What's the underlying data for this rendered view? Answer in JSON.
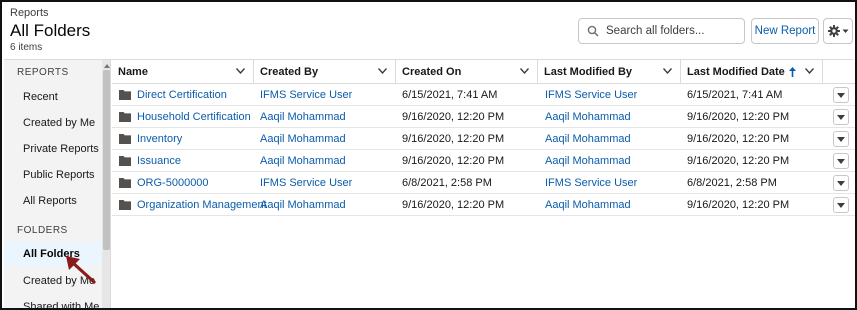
{
  "header": {
    "breadcrumb": "Reports",
    "title": "All Folders",
    "item_count": "6 items",
    "search_placeholder": "Search all folders...",
    "new_report_label": "New Report"
  },
  "sidebar": {
    "reports_section": "REPORTS",
    "reports_items": [
      "Recent",
      "Created by Me",
      "Private Reports",
      "Public Reports",
      "All Reports"
    ],
    "folders_section": "FOLDERS",
    "folders_items": [
      "All Folders",
      "Created by Me",
      "Shared with Me"
    ],
    "active_item": "All Folders"
  },
  "table": {
    "columns": [
      "Name",
      "Created By",
      "Created On",
      "Last Modified By",
      "Last Modified Date"
    ],
    "sorted_column": "Last Modified Date",
    "sort_direction": "ascending",
    "rows": [
      {
        "name": "Direct Certification",
        "created_by": "IFMS Service User",
        "created_on": "6/15/2021, 7:41 AM",
        "modified_by": "IFMS Service User",
        "modified_date": "6/15/2021, 7:41 AM"
      },
      {
        "name": "Household Certification",
        "created_by": "Aaqil Mohammad",
        "created_on": "9/16/2020, 12:20 PM",
        "modified_by": "Aaqil Mohammad",
        "modified_date": "9/16/2020, 12:20 PM"
      },
      {
        "name": "Inventory",
        "created_by": "Aaqil Mohammad",
        "created_on": "9/16/2020, 12:20 PM",
        "modified_by": "Aaqil Mohammad",
        "modified_date": "9/16/2020, 12:20 PM"
      },
      {
        "name": "Issuance",
        "created_by": "Aaqil Mohammad",
        "created_on": "9/16/2020, 12:20 PM",
        "modified_by": "Aaqil Mohammad",
        "modified_date": "9/16/2020, 12:20 PM"
      },
      {
        "name": "ORG-5000000",
        "created_by": "IFMS Service User",
        "created_on": "6/8/2021, 2:58 PM",
        "modified_by": "IFMS Service User",
        "modified_date": "6/8/2021, 2:58 PM"
      },
      {
        "name": "Organization Management",
        "created_by": "Aaqil Mohammad",
        "created_on": "9/16/2020, 12:20 PM",
        "modified_by": "Aaqil Mohammad",
        "modified_date": "9/16/2020, 12:20 PM"
      }
    ]
  },
  "colors": {
    "link": "#0b5cab",
    "active_nav_bg": "#eaf5fe",
    "sidebar_bg": "#f3f3f3",
    "annotation_arrow": "#8b1a1a"
  },
  "icons": [
    "search-icon",
    "gear-icon",
    "chevron-down-icon",
    "sort-arrow-up-icon",
    "folder-icon",
    "row-menu-icon",
    "annotation-arrow-icon"
  ]
}
